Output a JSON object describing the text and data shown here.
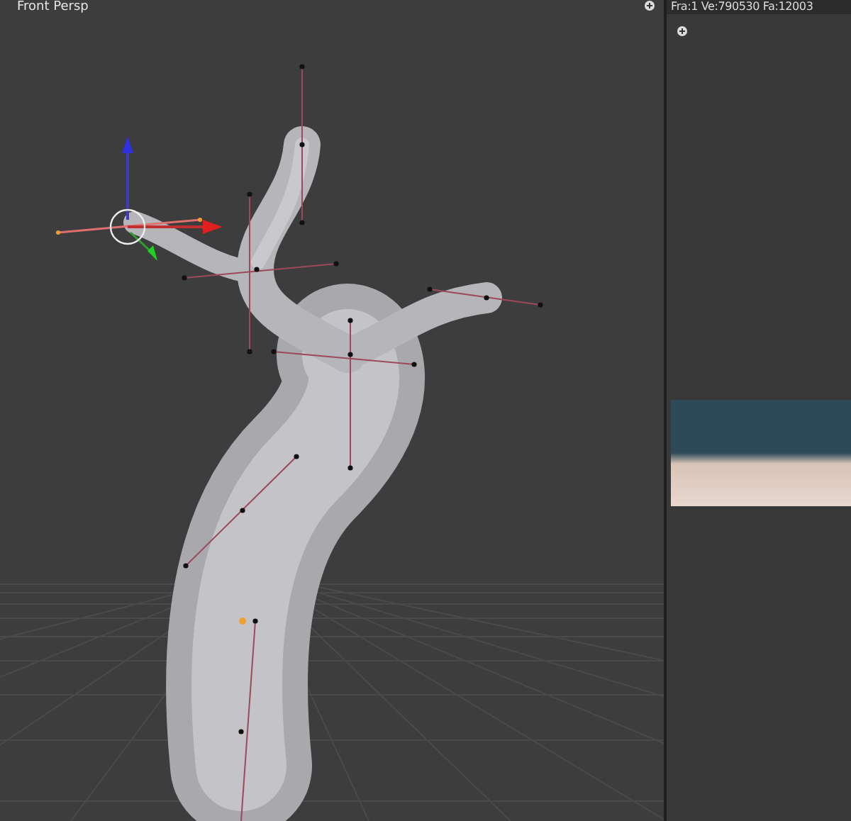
{
  "viewport": {
    "label": "Front Persp"
  },
  "render_panel": {
    "status": "Fra:1  Ve:790530 Fa:12003"
  }
}
